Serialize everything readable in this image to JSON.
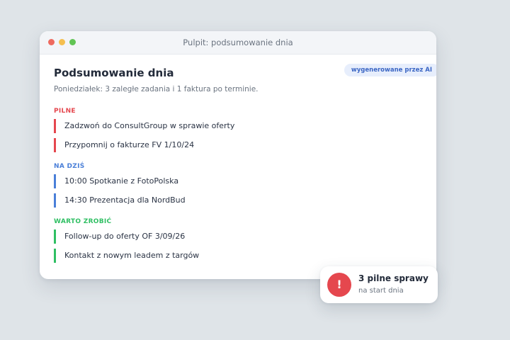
{
  "window": {
    "title": "Pulpit: podsumowanie dnia"
  },
  "summary": {
    "heading": "Podsumowanie dnia",
    "ai_badge": "wygenerowane przez AI",
    "subtitle": "Poniedziałek: 3 zaległe zadania i 1 faktura po terminie."
  },
  "sections": [
    {
      "label": "PILNE",
      "color": "#e5474e",
      "items": [
        "Zadzwoń do ConsultGroup w sprawie oferty",
        "Przypomnij o fakturze FV 1/10/24"
      ]
    },
    {
      "label": "NA DZIŚ",
      "color": "#4a7fd8",
      "items": [
        "10:00 Spotkanie z FotoPolska",
        "14:30 Prezentacja dla NordBud"
      ]
    },
    {
      "label": "WARTO ZROBIĆ",
      "color": "#2fbf63",
      "items": [
        "Follow-up do oferty OF 3/09/26",
        "Kontakt z nowym leadem z targów"
      ]
    }
  ],
  "toast": {
    "icon": "alert-icon",
    "icon_glyph": "!",
    "title": "3 pilne sprawy",
    "subtitle": "na start dnia"
  }
}
